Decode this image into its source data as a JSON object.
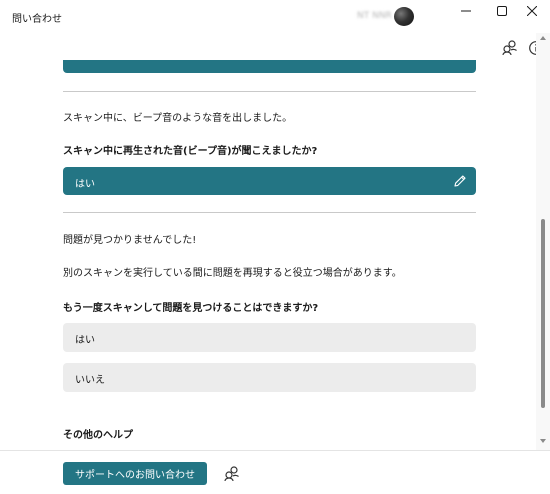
{
  "window": {
    "title": "問い合わせ",
    "account_name": "NT NNR"
  },
  "toolbar": {
    "share_icon": "share-icon",
    "info_icon": "info-icon"
  },
  "content": {
    "statement_beep": "スキャン中に、ビープ音のような音を出しました。",
    "question_beep": "スキャン中に再生された音(ビープ音)が聞こえましたか?",
    "selected_answer": "はい",
    "statement_not_found": "問題が見つかりませんでした!",
    "statement_reproduce": "別のスキャンを実行している間に問題を再現すると役立つ場合があります。",
    "question_rescan": "もう一度スキャンして問題を見つけることはできますか?",
    "options": [
      {
        "label": "はい"
      },
      {
        "label": "いいえ"
      }
    ],
    "more_help_heading": "その他のヘルプ"
  },
  "footer": {
    "contact_button": "サポートへのお問い合わせ"
  },
  "colors": {
    "accent": "#237584",
    "option_bg": "#ececec",
    "divider": "#c9c9c9"
  }
}
